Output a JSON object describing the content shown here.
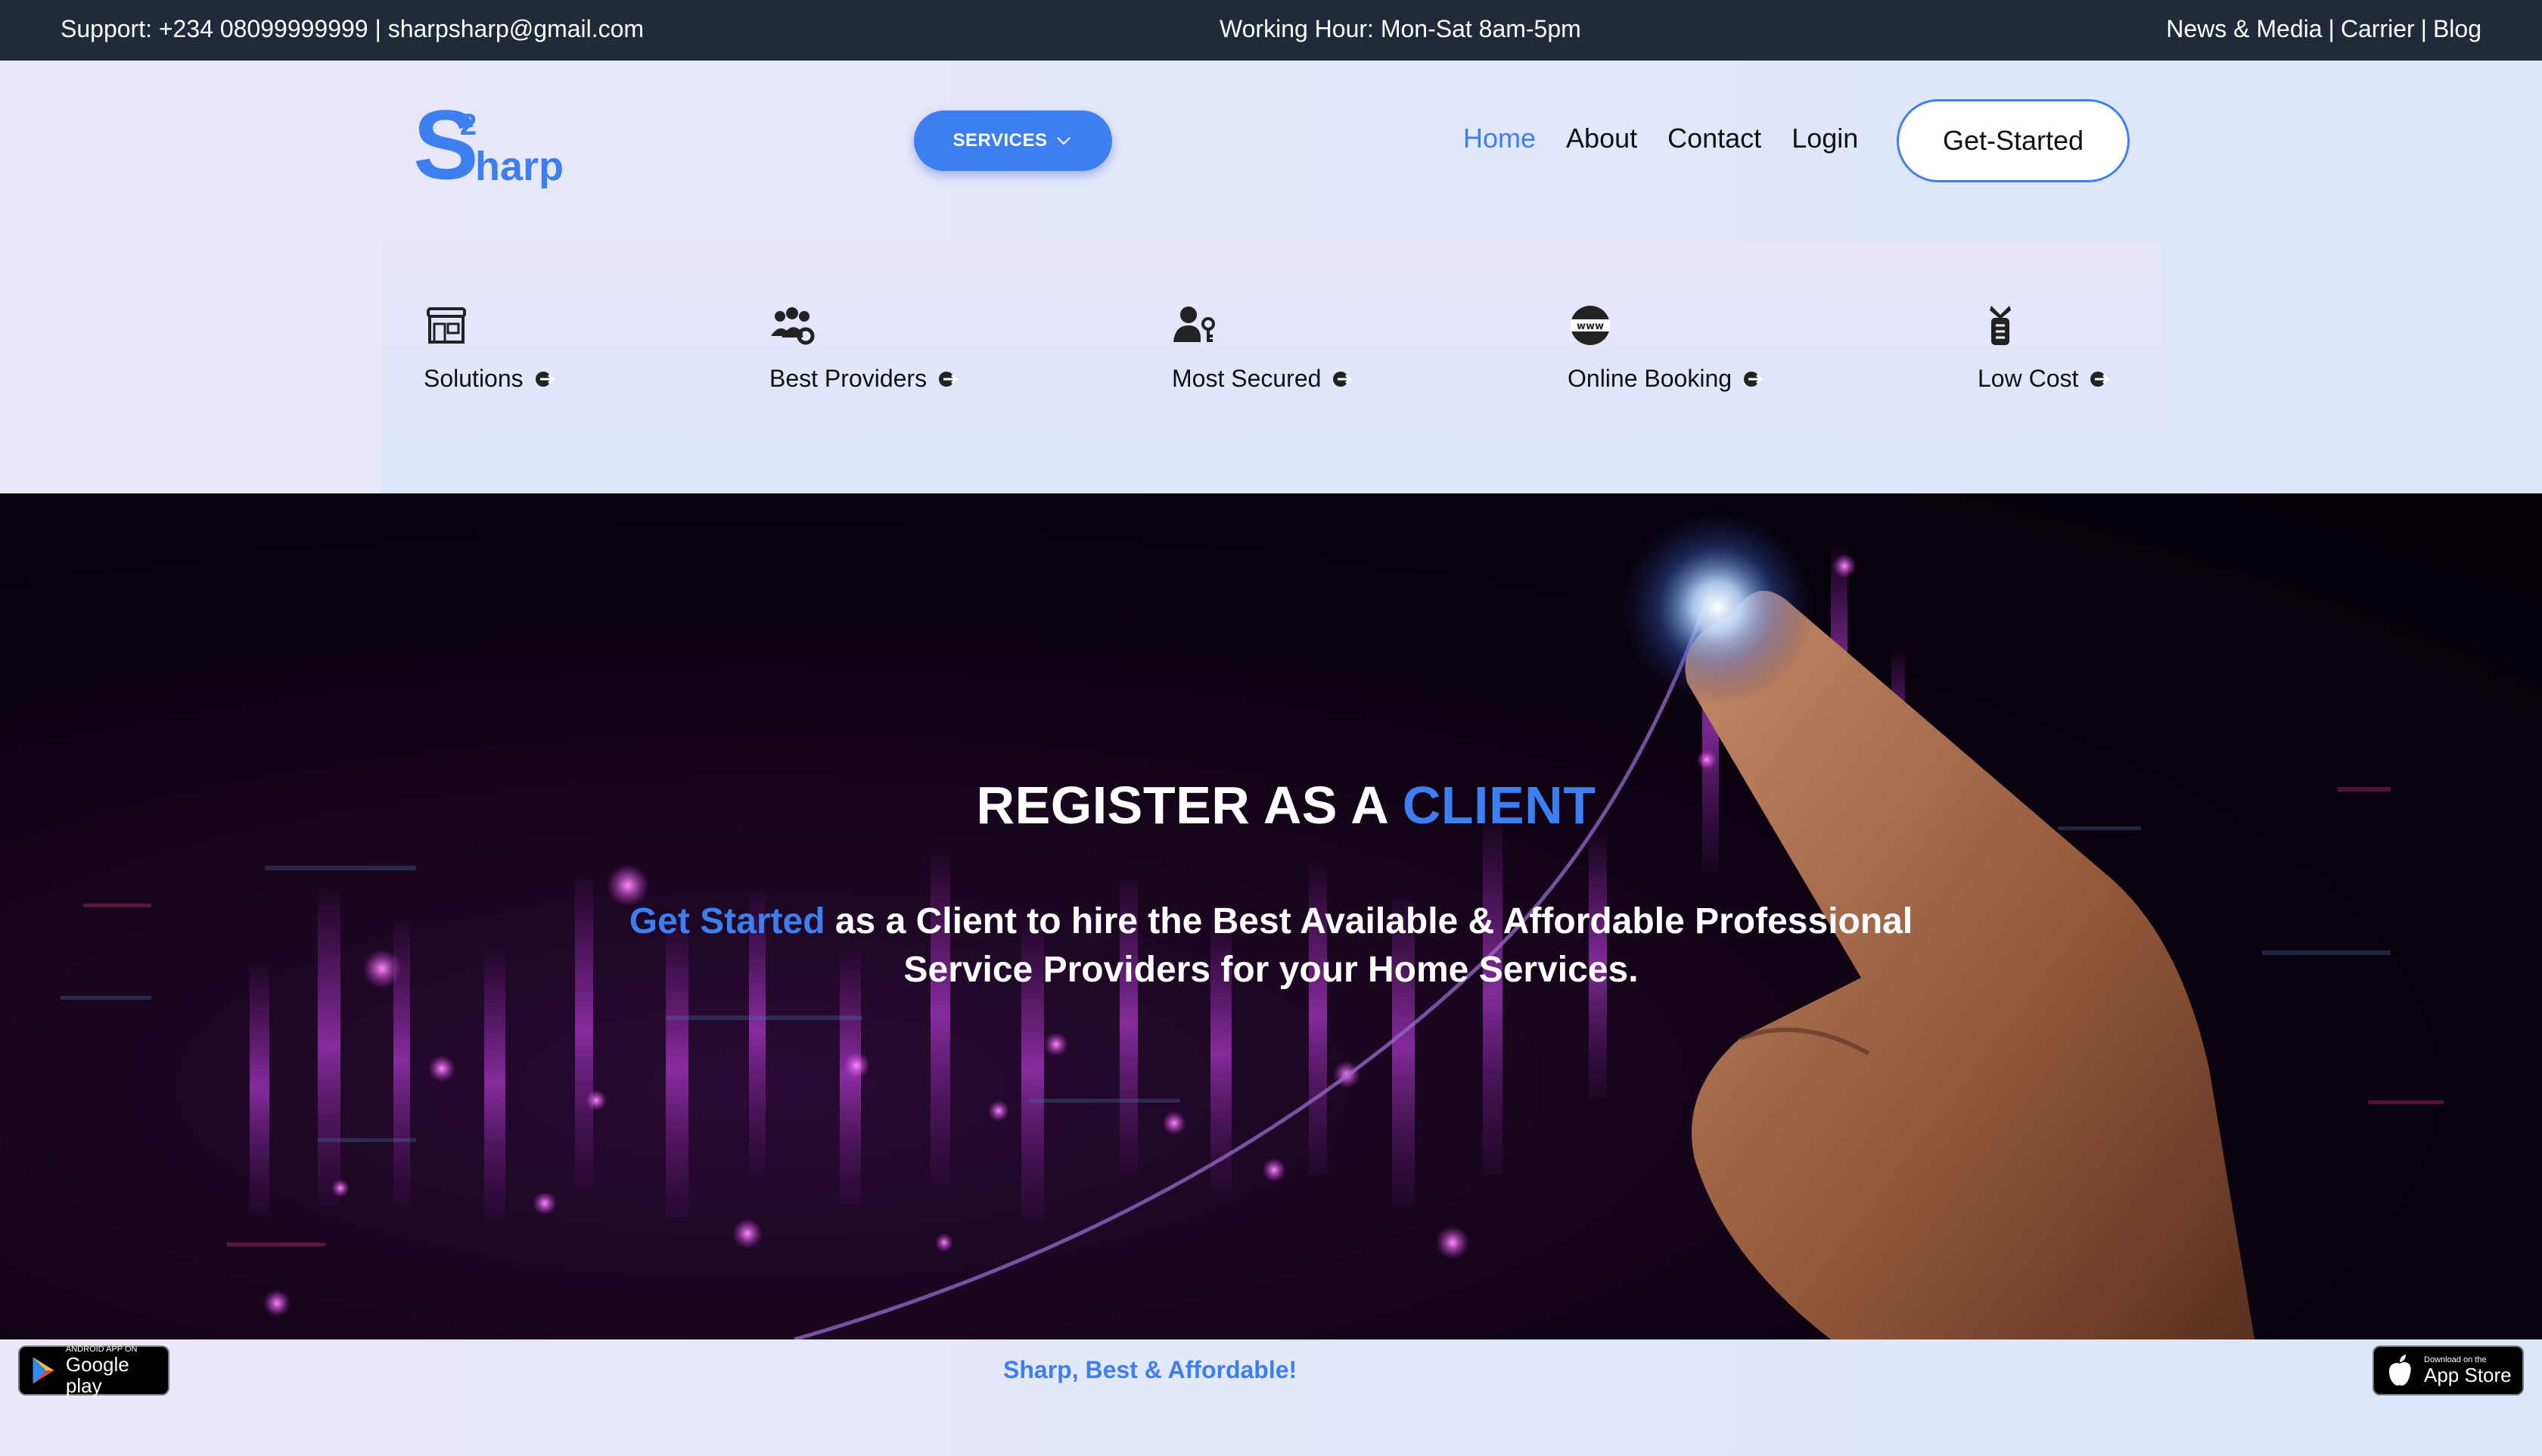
{
  "topbar": {
    "support": "Support: +234 08099999999 | sharpsharp@gmail.com",
    "working_hours": "Working Hour: Mon-Sat 8am-5pm",
    "links": [
      "News & Media",
      "Carrier",
      "Blog"
    ],
    "separator": "|"
  },
  "header": {
    "logo_letter": "S",
    "logo_superscript": "2",
    "logo_rest": "harp",
    "services_label": "SERVICES",
    "nav": [
      "Home",
      "About",
      "Contact",
      "Login"
    ],
    "active_nav": "Home",
    "cta_label": "Get-Started"
  },
  "features": [
    {
      "label": "Solutions",
      "icon": "store-icon"
    },
    {
      "label": "Best Providers",
      "icon": "people-gear-icon"
    },
    {
      "label": "Most Secured",
      "icon": "user-key-icon"
    },
    {
      "label": "Online Booking",
      "icon": "www-globe-icon"
    },
    {
      "label": "Low Cost",
      "icon": "money-icon"
    }
  ],
  "hero": {
    "title_main": "REGISTER AS A",
    "title_accent": "CLIENT",
    "subtitle_accent": "Get Started",
    "subtitle_rest": "as a Client to hire the Best Available & Affordable Professional Service Providers for your Home Services."
  },
  "footer": {
    "tagline": "Sharp, Best & Affordable!",
    "google_play_small": "ANDROID APP ON",
    "google_play_big": "Google play",
    "app_store_small": "Download on the",
    "app_store_big": "App Store"
  },
  "colors": {
    "accent": "#3d7ff0",
    "topbar_bg": "#212a3b",
    "hero_bg": "#0b020f"
  }
}
